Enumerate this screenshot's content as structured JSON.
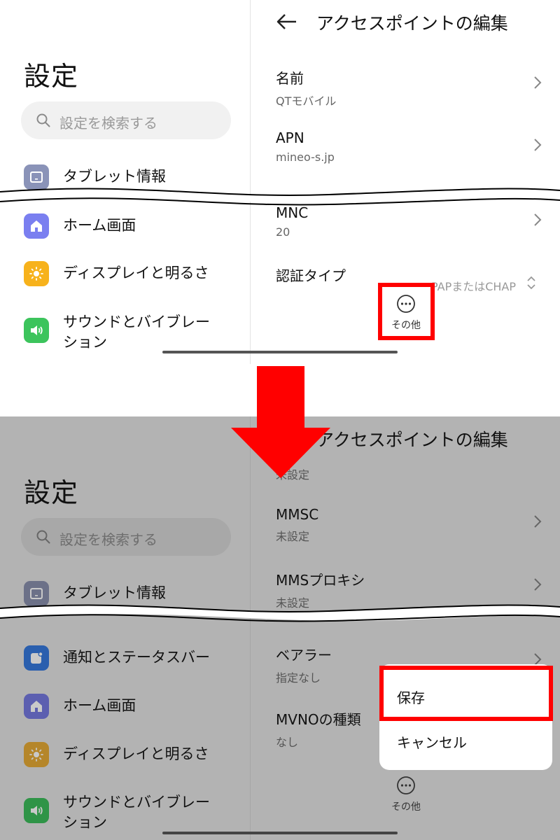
{
  "sidebar": {
    "title": "設定",
    "search_placeholder": "設定を検索する",
    "tablet_info": "タブレット情報",
    "home_screen": "ホーム画面",
    "display": "ディスプレイと明るさ",
    "sound_line1": "サウンドとバイブレー",
    "sound_line2": "ション",
    "notifications": "通知とステータスバー"
  },
  "edit_page": {
    "title": "アクセスポイントの編集",
    "top_rows": [
      {
        "label": "名前",
        "value": "QTモバイル"
      },
      {
        "label": "APN",
        "value": "mineo-s.jp"
      },
      {
        "label": "MNC",
        "value": "20"
      },
      {
        "label": "認証タイプ",
        "value": "PAPまたはCHAP"
      }
    ],
    "bottom_rows": [
      {
        "label": "",
        "value": "未設定"
      },
      {
        "label": "MMSC",
        "value": "未設定"
      },
      {
        "label": "MMSプロキシ",
        "value": "未設定"
      },
      {
        "label": "ベアラー",
        "value": "指定なし"
      },
      {
        "label": "MVNOの種類",
        "value": "なし"
      }
    ],
    "more_label": "その他"
  },
  "popup_menu": {
    "save": "保存",
    "cancel": "キャンセル"
  },
  "colors": {
    "highlight": "#ff0000",
    "dim_overlay": "#b3b3b3",
    "icon_tablet": "#8a93b8",
    "icon_home": "#7a7ff0",
    "icon_display": "#f7b21c",
    "icon_sound": "#3cc45c",
    "icon_notify": "#2d7ff0"
  },
  "icons": [
    "back-arrow-icon",
    "search-icon",
    "chevron-right-icon",
    "up-down-chevron-icon",
    "more-dots-icon",
    "tablet-icon",
    "home-icon",
    "sun-icon",
    "speaker-icon",
    "notification-icon"
  ]
}
